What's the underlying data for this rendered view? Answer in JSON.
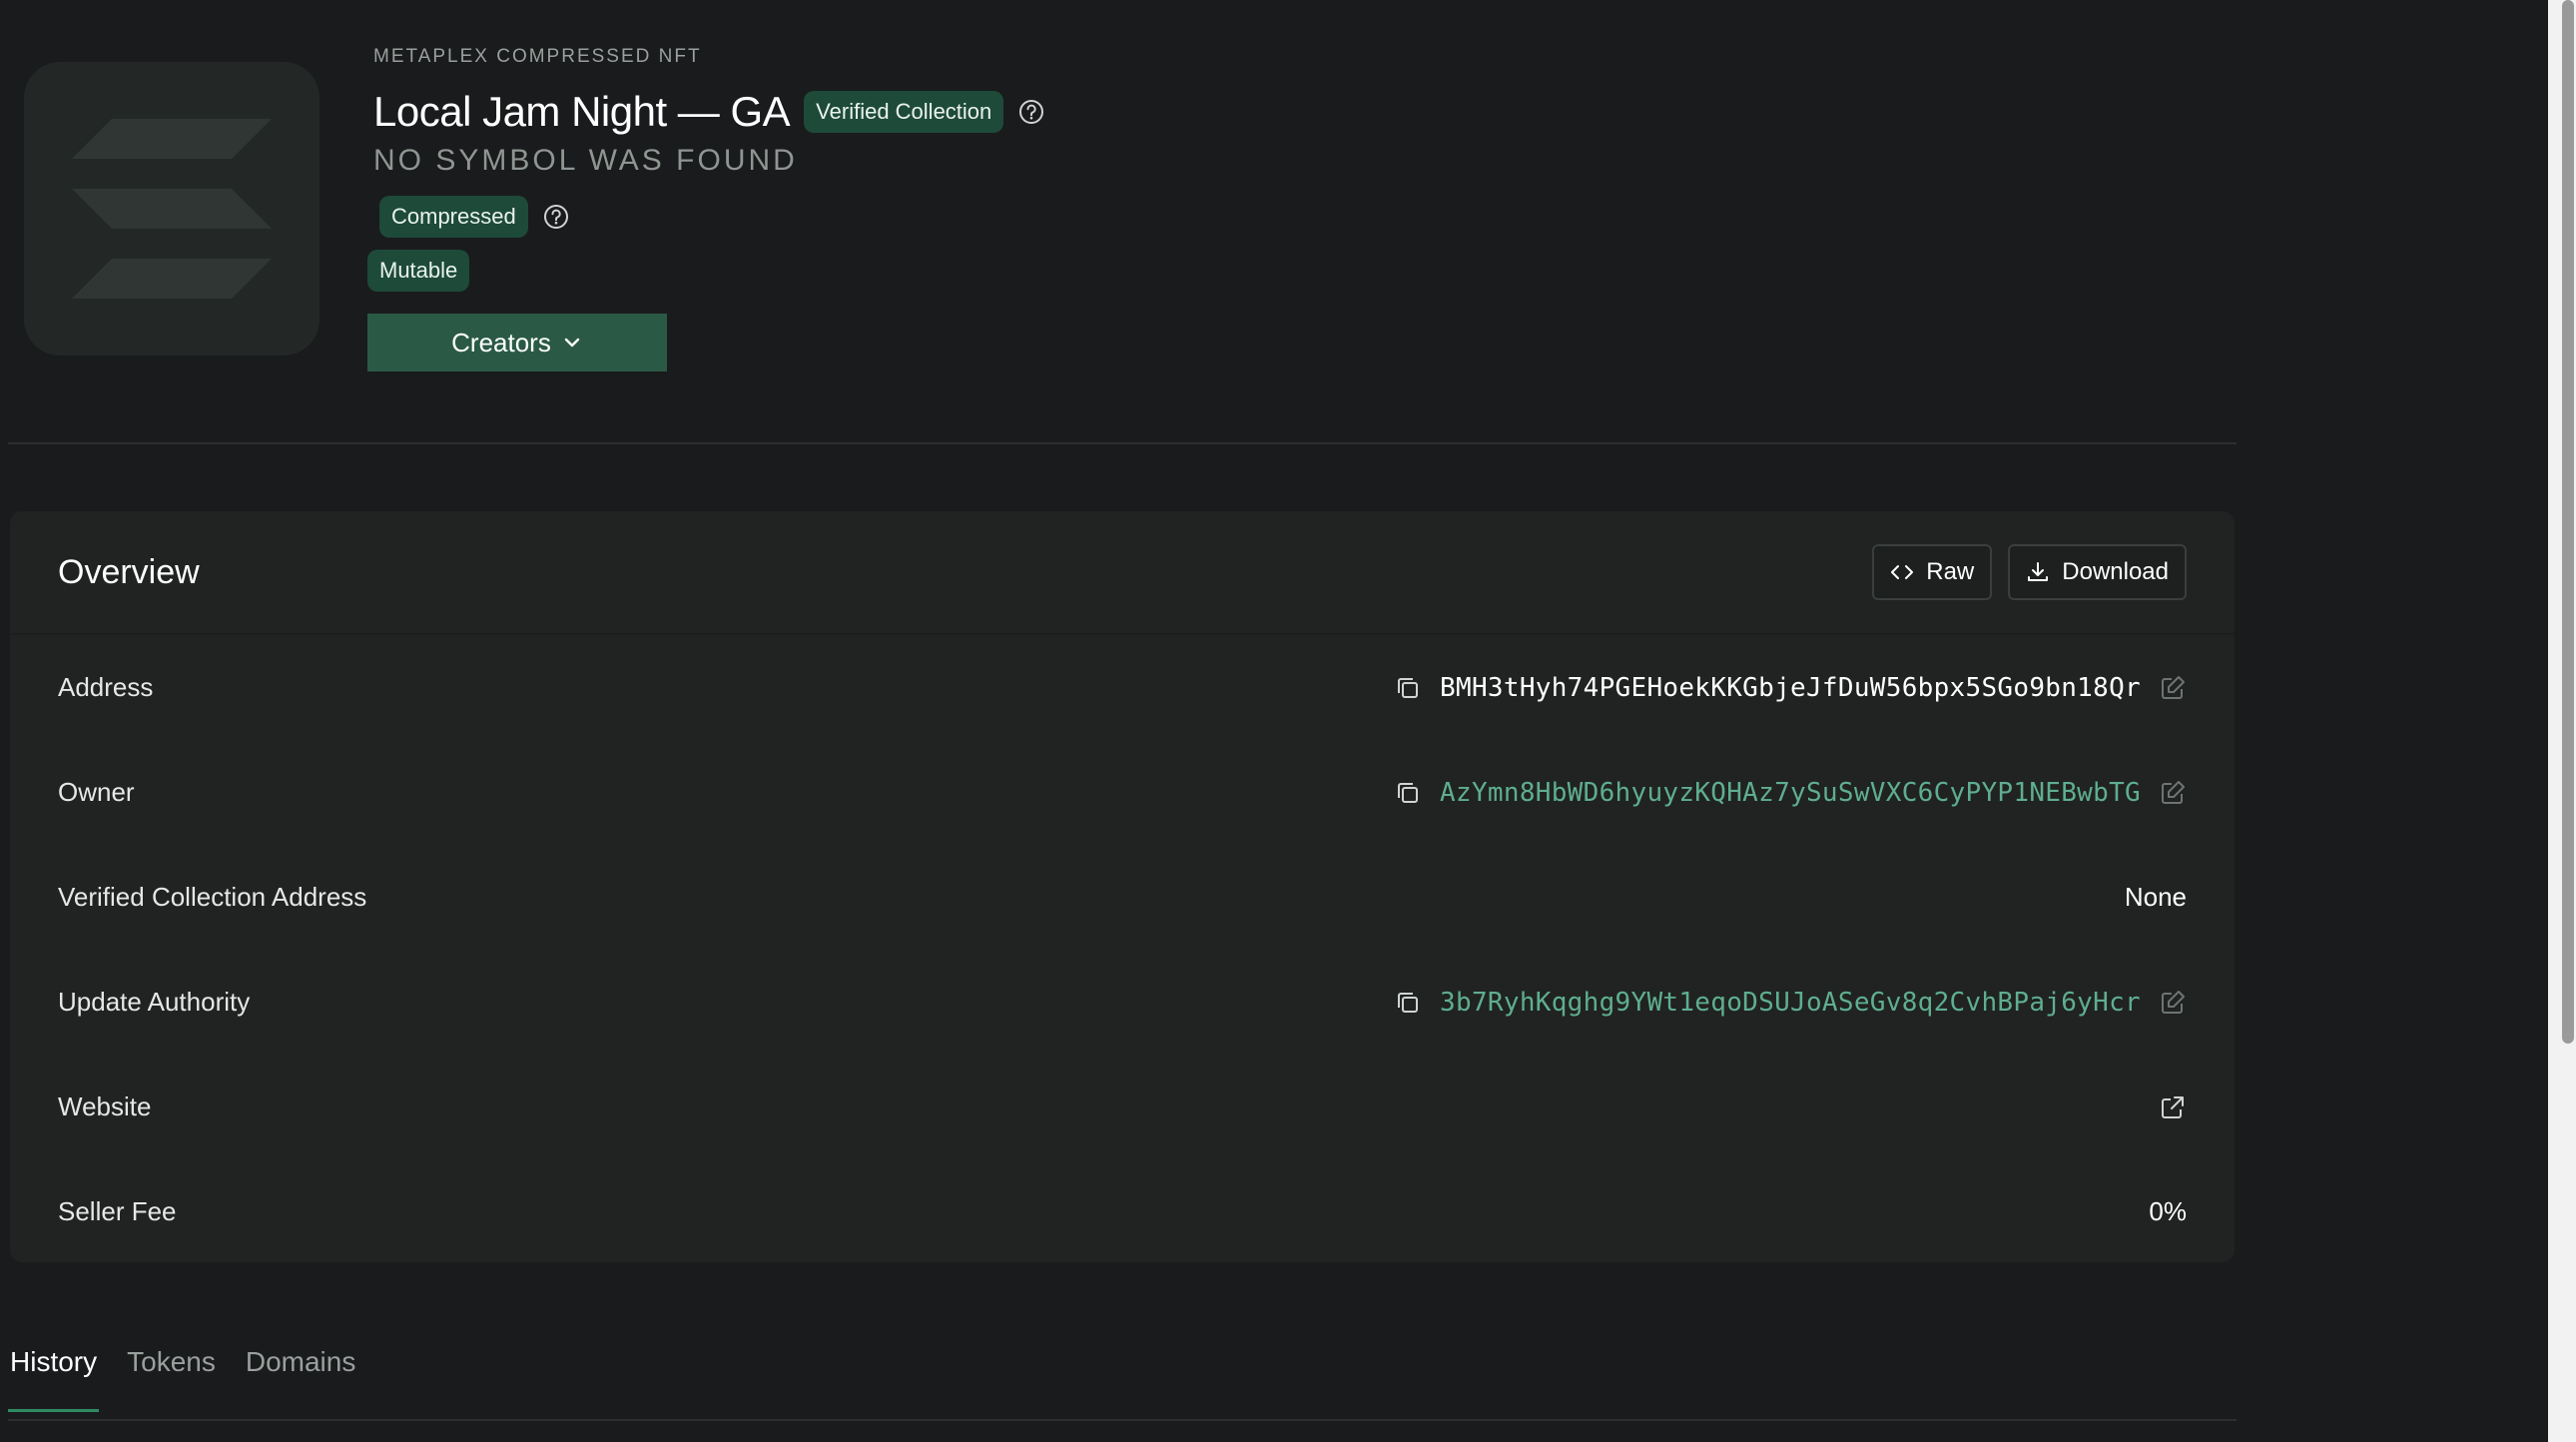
{
  "header": {
    "kicker": "METAPLEX COMPRESSED NFT",
    "title": "Local Jam Night — GA",
    "verified_badge": "Verified Collection",
    "symbol": "NO SYMBOL WAS FOUND",
    "compressed_badge": "Compressed",
    "mutable_badge": "Mutable",
    "creators_button": "Creators"
  },
  "overview": {
    "title": "Overview",
    "raw_button": "Raw",
    "download_button": "Download",
    "rows": [
      {
        "label": "Address",
        "value": "BMH3tHyh74PGEHoekKKGbjeJfDuW56bpx5SGo9bn18Qr"
      },
      {
        "label": "Owner",
        "value": "AzYmn8HbWD6hyuyzKQHAz7ySuSwVXC6CyPYP1NEBwbTG"
      },
      {
        "label": "Verified Collection Address",
        "value": "None"
      },
      {
        "label": "Update Authority",
        "value": "3b7RyhKqghg9YWt1eqoDSUJoASeGv8q2CvhBPaj6yHcr"
      },
      {
        "label": "Website",
        "value": ""
      },
      {
        "label": "Seller Fee",
        "value": "0%"
      }
    ]
  },
  "tabs": [
    {
      "label": "History",
      "active": true
    },
    {
      "label": "Tokens",
      "active": false
    },
    {
      "label": "Domains",
      "active": false
    }
  ],
  "colors": {
    "background": "#1a1b1c",
    "card": "#202322",
    "accent": "#2a5a46",
    "badge": "#1e4a3a",
    "link": "#5fae8f"
  }
}
